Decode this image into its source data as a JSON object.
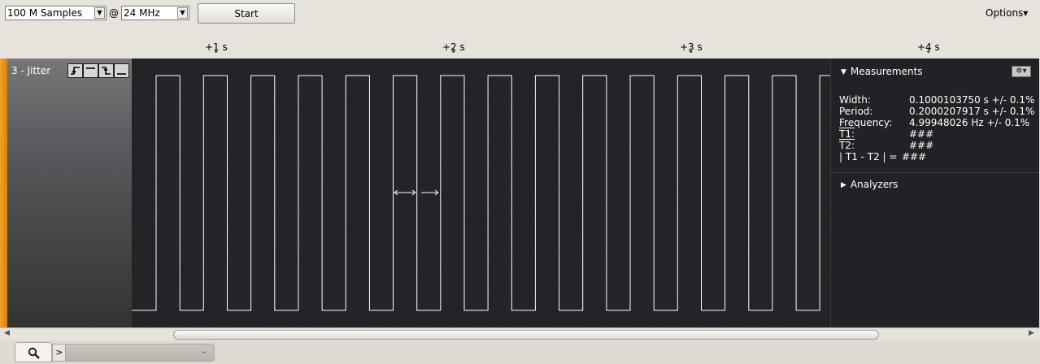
{
  "toolbar": {
    "samples_value": "100 M Samples",
    "at_symbol": "@",
    "rate_value": "24 MHz",
    "start_label": "Start",
    "options_label": "Options▾"
  },
  "ruler": {
    "ticks": [
      "+1 s",
      "+2 s",
      "+3 s",
      "+4 s"
    ]
  },
  "channel": {
    "name": "3 - Jitter",
    "accent_color": "#f0a030",
    "waveform_color": "#ffffff",
    "pulse_count": 15
  },
  "measurements": {
    "header": "Measurements",
    "rows": [
      {
        "label": "Width:",
        "value": "0.1000103750 s +/- 0.1%"
      },
      {
        "label": "Period:",
        "value": "0.2000207917 s +/- 0.1%"
      },
      {
        "label": "Frequency:",
        "value": "4.99948026 Hz +/- 0.1%"
      },
      {
        "label": "T1:",
        "value": "###"
      },
      {
        "label": "T2:",
        "value": "###"
      },
      {
        "label": "| T1 - T2 | =",
        "value": "###"
      }
    ]
  },
  "analyzers": {
    "header": "Analyzers"
  },
  "icons": {
    "search": "search-icon",
    "gear": "gear-icon",
    "chevron": "chevron-down-icon"
  }
}
